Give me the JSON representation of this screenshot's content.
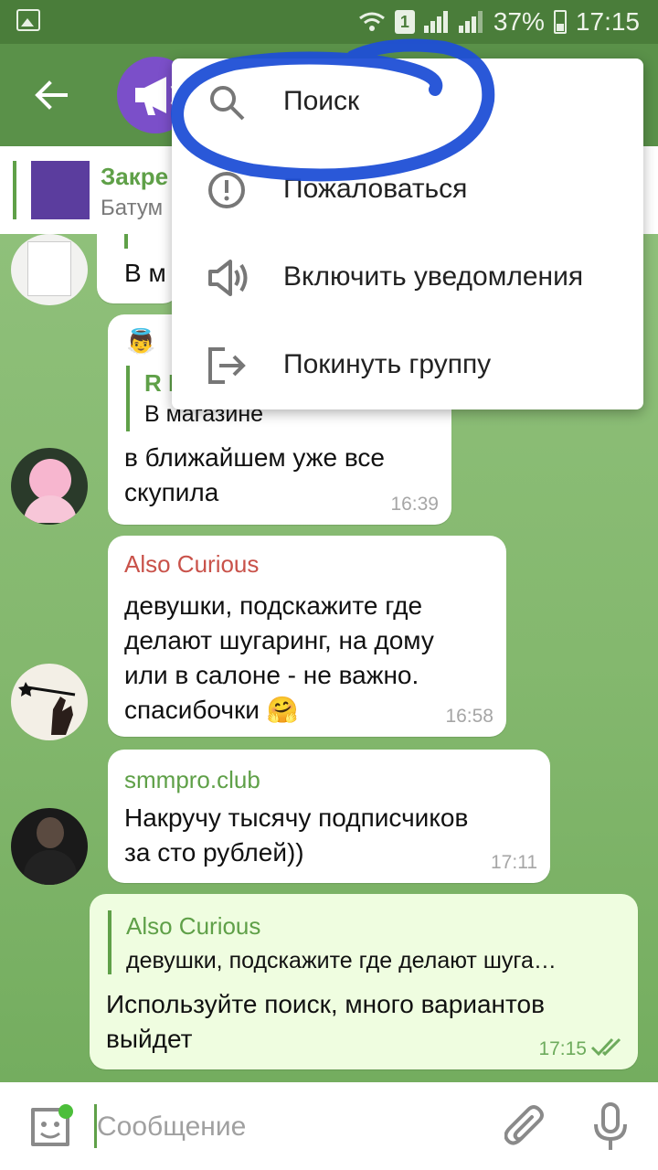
{
  "status_bar": {
    "sim_slot": "1",
    "battery_percent": "37%",
    "time": "17:15"
  },
  "pinned": {
    "title": "Закре",
    "subtitle": "Батум"
  },
  "messages": [
    {
      "id": "partial",
      "text": "В м"
    },
    {
      "id": "rk",
      "quote_sender": "R I",
      "quote_text": "В магазине",
      "text_line1": "в ближайшем уже все",
      "text_line2": "скупила",
      "time": "16:39"
    },
    {
      "id": "curious",
      "sender": "Also Curious",
      "text_line1": "девушки, подскажите где",
      "text_line2": "делают шугаринг, на дому",
      "text_line3": "или в салоне - не важно.",
      "text_line4": "спасибочки 🤗",
      "time": "16:58"
    },
    {
      "id": "smmpro",
      "sender": "smmpro.club",
      "text_line1": "Накручу тысячу подписчиков",
      "text_line2": "за сто рублей))",
      "time": "17:11"
    },
    {
      "id": "own",
      "quote_sender": "Also Curious",
      "quote_text": "девушки, подскажите где делают шуга…",
      "text_line1": "Используйте поиск, много вариантов",
      "text_line2": "выйдет",
      "time": "17:15"
    }
  ],
  "input": {
    "placeholder": "Сообщение"
  },
  "menu": {
    "items": [
      {
        "label": "Поиск",
        "icon": "search-icon"
      },
      {
        "label": "Пожаловаться",
        "icon": "report-icon"
      },
      {
        "label": "Включить уведомления",
        "icon": "speaker-icon"
      },
      {
        "label": "Покинуть группу",
        "icon": "leave-icon"
      }
    ]
  },
  "colors": {
    "header": "#5a9149",
    "status_bar": "#4a7d3a",
    "accent_green": "#5fa048",
    "sender_red": "#c9524a",
    "scribble_blue": "#1f4fd6"
  }
}
